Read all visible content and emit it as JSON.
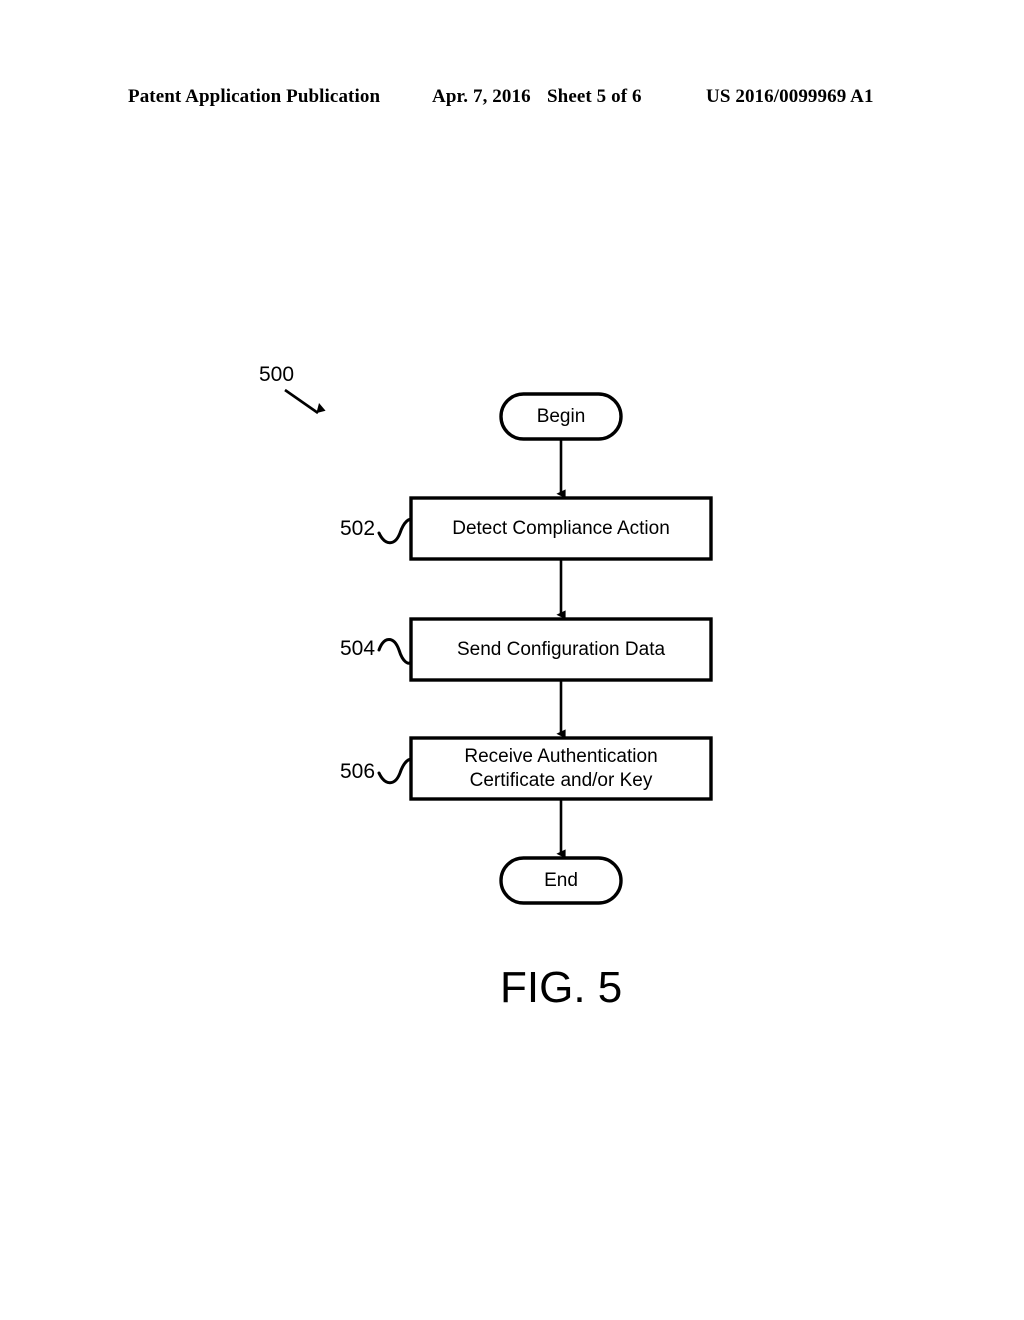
{
  "header": {
    "publication": "Patent Application Publication",
    "date": "Apr. 7, 2016",
    "sheet": "Sheet 5 of 6",
    "publication_number": "US 2016/0099969 A1"
  },
  "figure": {
    "caption": "FIG. 5",
    "diagram_reference": "500",
    "nodes": [
      {
        "id": "begin",
        "type": "terminator",
        "label": "Begin"
      },
      {
        "id": "step502",
        "type": "process",
        "ref": "502",
        "label": "Detect Compliance Action"
      },
      {
        "id": "step504",
        "type": "process",
        "ref": "504",
        "label": "Send Configuration Data"
      },
      {
        "id": "step506",
        "type": "process",
        "ref": "506",
        "label": "Receive Authentication\nCertificate and/or Key"
      },
      {
        "id": "end",
        "type": "terminator",
        "label": "End"
      }
    ]
  },
  "colors": {
    "ink": "#000000",
    "paper": "#ffffff"
  }
}
